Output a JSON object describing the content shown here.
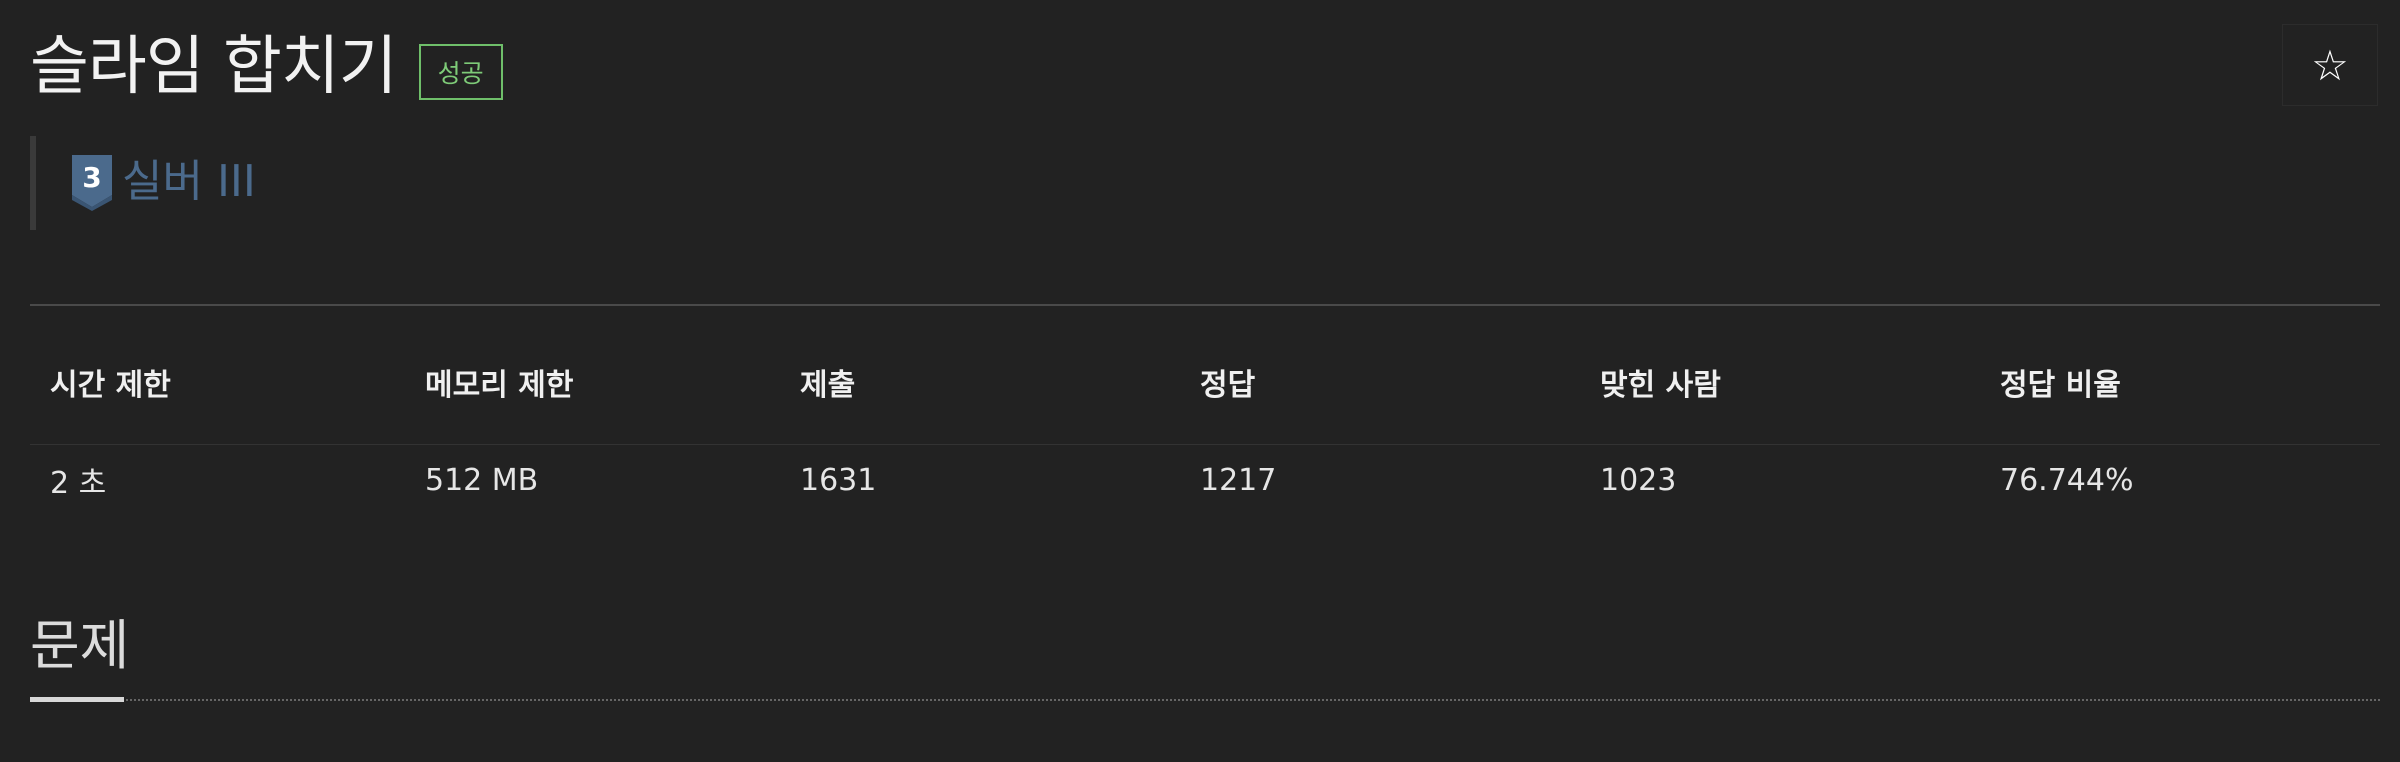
{
  "problem": {
    "title": "슬라임 합치기",
    "status": "성공"
  },
  "star_button": {
    "icon": "star-outline-icon",
    "label": "☆"
  },
  "tier": {
    "level": "3",
    "label": "실버 III",
    "color": "#4b6a8c"
  },
  "info": {
    "headers": [
      "시간 제한",
      "메모리 제한",
      "제출",
      "정답",
      "맞힌 사람",
      "정답 비율"
    ],
    "values": [
      "2 초",
      "512 MB",
      "1631",
      "1217",
      "1023",
      "76.744%"
    ]
  },
  "section": {
    "title": "문제"
  },
  "colors": {
    "background": "#222222",
    "success": "#7ecb78",
    "tier_silver": "#4b6a8c"
  }
}
